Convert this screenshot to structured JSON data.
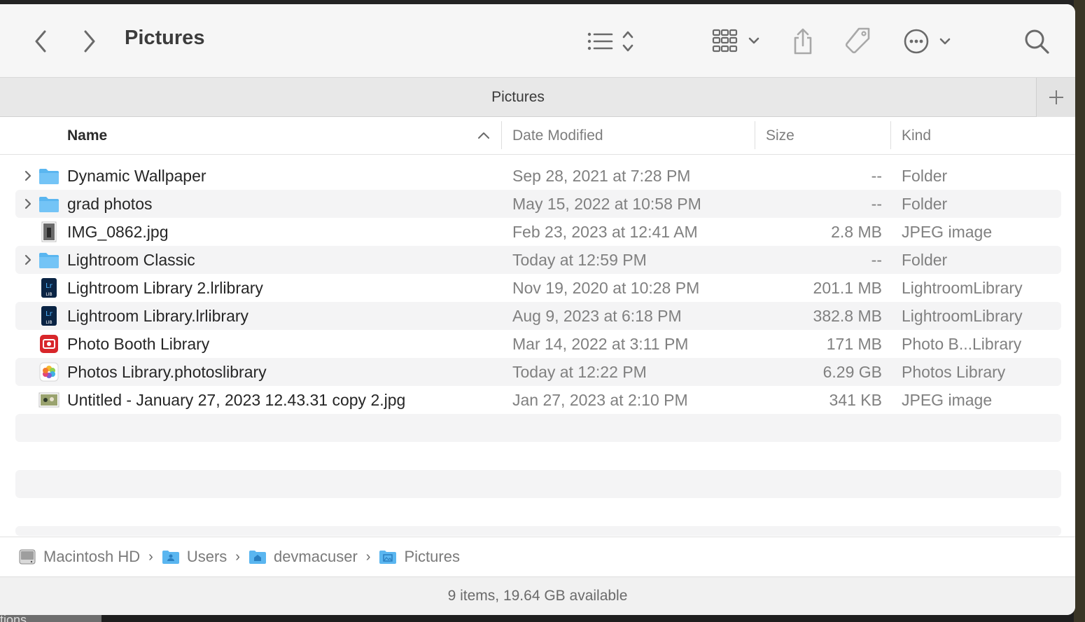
{
  "window": {
    "title": "Pictures"
  },
  "tabs": [
    {
      "label": "Pictures"
    }
  ],
  "columns": {
    "name": "Name",
    "date": "Date Modified",
    "size": "Size",
    "kind": "Kind"
  },
  "files": [
    {
      "name": "Dynamic Wallpaper",
      "date": "Sep 28, 2021 at 7:28 PM",
      "size": "--",
      "kind": "Folder",
      "icon": "folder-icon",
      "expandable": true
    },
    {
      "name": "grad photos",
      "date": "May 15, 2022 at 10:58 PM",
      "size": "--",
      "kind": "Folder",
      "icon": "folder-icon",
      "expandable": true
    },
    {
      "name": "IMG_0862.jpg",
      "date": "Feb 23, 2023 at 12:41 AM",
      "size": "2.8 MB",
      "kind": "JPEG image",
      "icon": "jpeg-thumbnail-icon",
      "expandable": false
    },
    {
      "name": "Lightroom Classic",
      "date": "Today at 12:59 PM",
      "size": "--",
      "kind": "Folder",
      "icon": "folder-icon",
      "expandable": true
    },
    {
      "name": "Lightroom Library 2.lrlibrary",
      "date": "Nov 19, 2020 at 10:28 PM",
      "size": "201.1 MB",
      "kind": "LightroomLibrary",
      "icon": "lightroom-library-icon",
      "expandable": false
    },
    {
      "name": "Lightroom Library.lrlibrary",
      "date": "Aug 9, 2023 at 6:18 PM",
      "size": "382.8 MB",
      "kind": "LightroomLibrary",
      "icon": "lightroom-library-icon",
      "expandable": false
    },
    {
      "name": "Photo Booth Library",
      "date": "Mar 14, 2022 at 3:11 PM",
      "size": "171 MB",
      "kind": "Photo B...Library",
      "icon": "photo-booth-icon",
      "expandable": false
    },
    {
      "name": "Photos Library.photoslibrary",
      "date": "Today at 12:22 PM",
      "size": "6.29 GB",
      "kind": "Photos Library",
      "icon": "photos-library-icon",
      "expandable": false
    },
    {
      "name": "Untitled - January 27, 2023 12.43.31 copy 2.jpg",
      "date": "Jan 27, 2023 at 2:10 PM",
      "size": "341 KB",
      "kind": "JPEG image",
      "icon": "image-thumbnail-icon",
      "expandable": false
    }
  ],
  "path": [
    {
      "label": "Macintosh HD",
      "icon": "hard-drive-icon"
    },
    {
      "label": "Users",
      "icon": "users-folder-icon"
    },
    {
      "label": "devmacuser",
      "icon": "home-folder-icon"
    },
    {
      "label": "Pictures",
      "icon": "pictures-folder-icon"
    }
  ],
  "status": "9 items, 19.64 GB available",
  "desktop": {
    "bottom_left_text": "tions"
  },
  "colors": {
    "folder": "#5ab6f0",
    "lightroom": "#0a2444",
    "lightroom_text": "#4fb4ff",
    "photo_booth": "#d8262a"
  }
}
